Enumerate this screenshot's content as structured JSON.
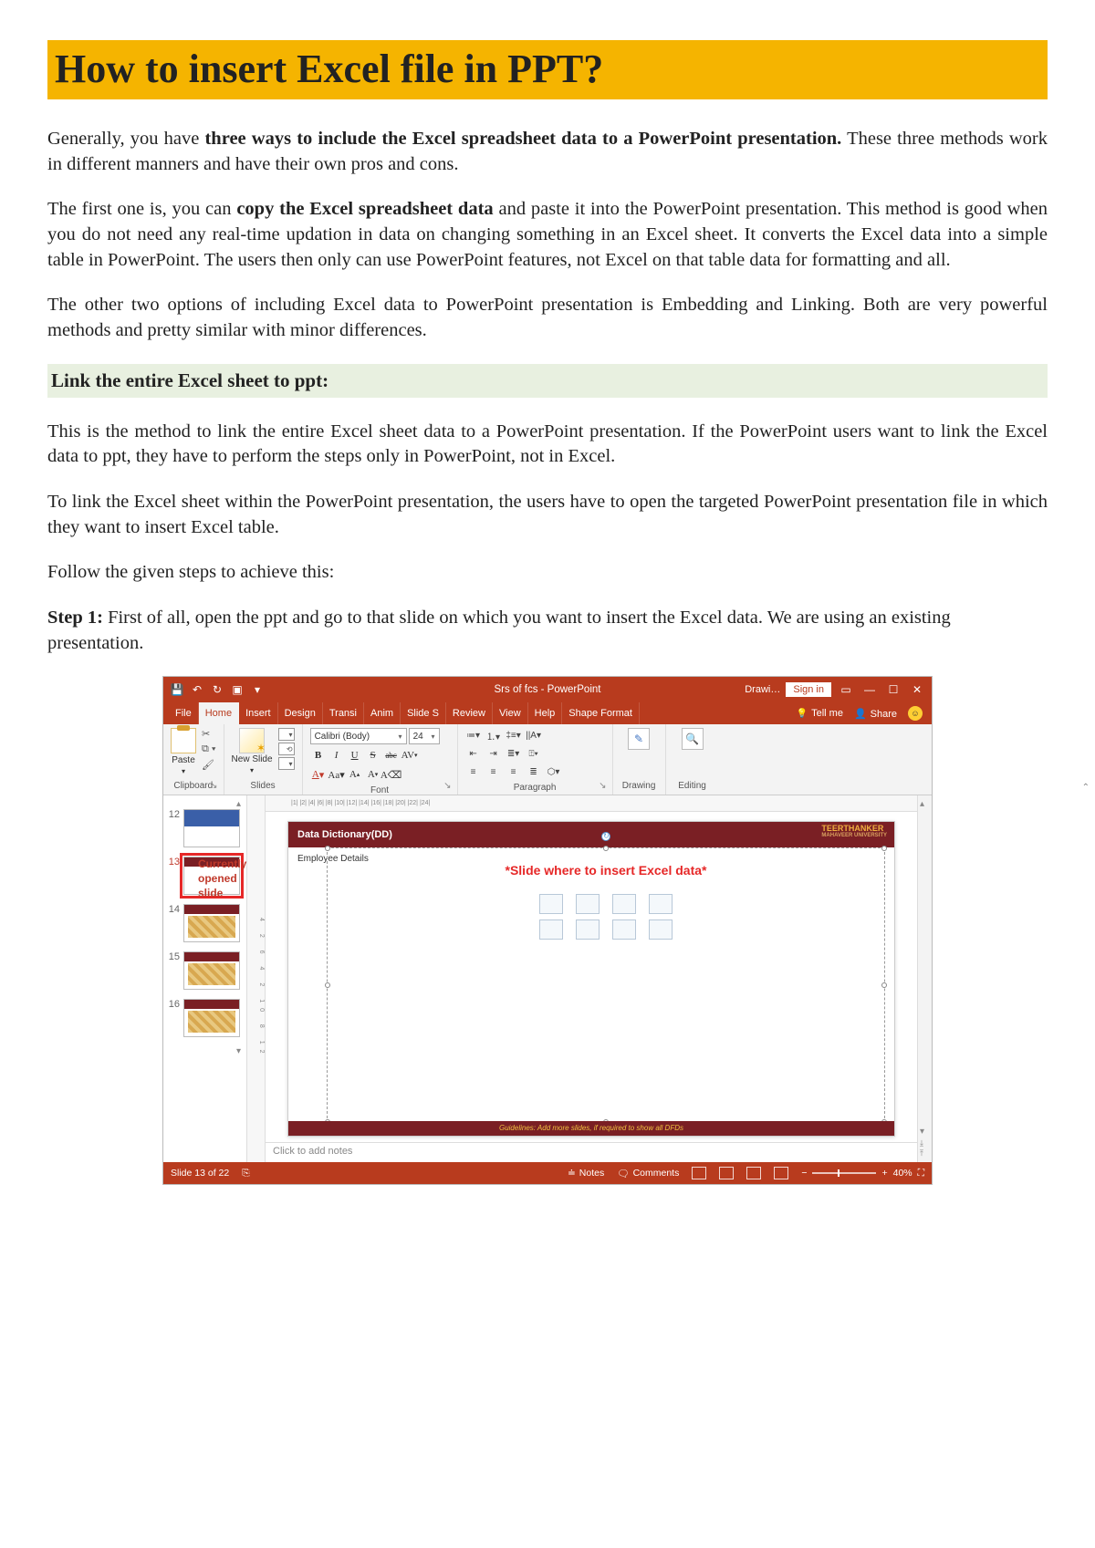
{
  "title": "How to insert Excel file in PPT?",
  "para1": {
    "pre": "Generally, you have ",
    "bold": "three ways to include the Excel spreadsheet data to a PowerPoint presentation.",
    "post": " These three methods work in different manners and have their own pros and cons."
  },
  "para2": {
    "pre": "The first one is, you can ",
    "bold": "copy the Excel spreadsheet data",
    "post": " and paste it into the PowerPoint presentation. This method is good when you do not need any real-time updation in data on changing something in an Excel sheet. It converts the Excel data into a simple table in PowerPoint. The users then only can use PowerPoint features, not Excel on that table data for formatting and all."
  },
  "para3": "The other two options of including Excel data to PowerPoint presentation is Embedding and Linking. Both are very powerful methods and pretty similar with minor differences.",
  "section_heading": "Link the entire Excel sheet to ppt:",
  "para4": "This is the method to link the entire Excel sheet data to a PowerPoint presentation. If the PowerPoint users want to link the Excel data to ppt, they have to perform the steps only in PowerPoint, not in Excel.",
  "para5": "To link the Excel sheet within the PowerPoint presentation, the users have to open the targeted PowerPoint presentation file in which they want to insert Excel table.",
  "para6": "Follow the given steps to achieve this:",
  "step1": {
    "label": "Step 1:",
    "text": " First of all, open the ppt and go to that slide on which you want to insert the Excel data. We are using an existing presentation."
  },
  "ppt": {
    "titlebar_center": "Srs of fcs  -  PowerPoint",
    "drawing_label": "Drawi…",
    "sign_in": "Sign in",
    "tabs": [
      "File",
      "Home",
      "Insert",
      "Design",
      "Transi",
      "Anim",
      "Slide S",
      "Review",
      "View",
      "Help",
      "Shape Format"
    ],
    "tell_me": "Tell me",
    "share": "Share",
    "paste_label": "Paste",
    "new_slide_label": "New Slide",
    "font_name": "Calibri (Body)",
    "font_size": "24",
    "drawing_group": "Drawing",
    "editing_group": "Editing",
    "group_labels": {
      "clipboard": "Clipboard",
      "slides": "Slides",
      "font": "Font",
      "paragraph": "Paragraph"
    },
    "ruler_text": "|1|  |2|  |4|  |6|  |8|  |10|  |12|  |14|  |16|  |18|  |20|  |22|  |24|",
    "vruler_text": "4  2  6  4  2  10  8  12",
    "annotation": "Currently opened slide",
    "thumbs": [
      "12",
      "13",
      "14",
      "15",
      "16"
    ],
    "slide": {
      "title": "Data Dictionary(DD)",
      "logo_top": "TEERTHANKER",
      "logo_sub": "MAHAVEER UNIVERSITY",
      "emp_label": "Employee Details",
      "placeholder_msg": "*Slide where to insert Excel data*",
      "footer": "Guidelines: Add more slides, if required to show all DFDs"
    },
    "notes_placeholder": "Click to add notes",
    "status": {
      "slide_of": "Slide 13 of 22",
      "notes": "Notes",
      "comments": "Comments",
      "zoom_pct": "40%"
    }
  }
}
